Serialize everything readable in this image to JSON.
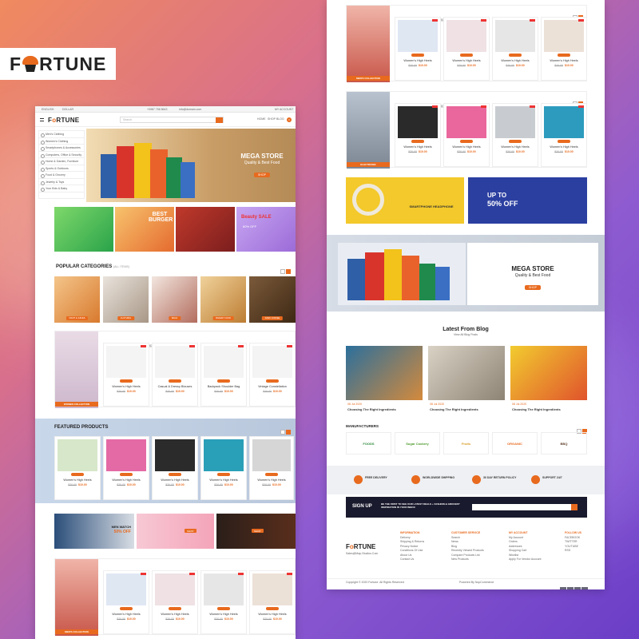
{
  "brand": {
    "name_pre": "F",
    "name_post": "RTUNE",
    "colors": {
      "accent": "#e86a1e",
      "dark": "#1a1a2e"
    }
  },
  "left_page": {
    "topbar": {
      "lang": "ENGLISH",
      "currency": "DOLLAR",
      "phone": "+0987 756 5643",
      "email": "info@domain.com",
      "wishlist": "WL",
      "account": "MY ACCOUNT",
      "cart_count": "0"
    },
    "header": {
      "logo_pre": "F",
      "logo_post": "RTUNE",
      "search_placeholder": "Search",
      "nav": [
        "HOME",
        "SHOP",
        "BLOG",
        "CONTACT US"
      ]
    },
    "sidebar": [
      "Men's Clothing",
      "Women's Clothing",
      "Smartphones & Accessories",
      "Computers, Office & Security",
      "Home & Garden, Furniture",
      "Sports & Outdoors",
      "Food & Grocery",
      "Jewelry & Toys",
      "Your Kids & Baby"
    ],
    "hero": {
      "title": "MEGA STORE",
      "subtitle": "Quality & Best Food",
      "button": "SHOP"
    },
    "promos": [
      {
        "text": ""
      },
      {
        "text": "BEST BURGER"
      },
      {
        "text": ""
      },
      {
        "text": "Beauty SALE",
        "sub": "60% OFF"
      }
    ],
    "popular": {
      "title": "POPULAR CATEGORIES",
      "tag": "(All items)",
      "items": [
        "FRUIT & JUICES",
        "CLOTHING",
        "BAGS",
        "BAKERY FOOD",
        "DARK COFFEE"
      ]
    },
    "products1": {
      "collection": "WOMEN COLLECTION",
      "tabs": [
        "NEW PRODUCT",
        "FEATURED",
        "BESTSELLER",
        "SPECIALS"
      ],
      "items": [
        {
          "name": "Women's High Heels",
          "old": "$20.00",
          "new": "$10.00"
        },
        {
          "name": "Casual & Dressy Blouses",
          "old": "$20.00",
          "new": "$10.00"
        },
        {
          "name": "Backpack Shoulder Bag",
          "old": "$20.00",
          "new": "$10.00"
        },
        {
          "name": "Vintage Constellation",
          "old": "$20.00",
          "new": "$10.00"
        }
      ]
    },
    "featured": {
      "title": "FEATURED PRODUCTS",
      "items": [
        {
          "name": "Women's High Heels",
          "old": "$20.00",
          "new": "$10.00"
        },
        {
          "name": "Women's High Heels",
          "old": "$20.00",
          "new": "$10.00"
        },
        {
          "name": "Women's High Heels",
          "old": "$20.00",
          "new": "$10.00"
        },
        {
          "name": "Women's High Heels",
          "old": "$20.00",
          "new": "$10.00"
        },
        {
          "name": "Women's High Heels",
          "old": "$20.00",
          "new": "$10.00"
        }
      ]
    },
    "banner_row": {
      "watch_title": "MEN WATCH",
      "watch_off": "50% OFF",
      "shop": "SHOP"
    },
    "products2": {
      "collection": "MEN'S COLLECTION",
      "items": [
        {
          "name": "Women's High Heels",
          "old": "$20.00",
          "new": "$10.00"
        },
        {
          "name": "Women's High Heels",
          "old": "$20.00",
          "new": "$10.00"
        },
        {
          "name": "Women's High Heels",
          "old": "$20.00",
          "new": "$10.00"
        },
        {
          "name": "Women's High Heels",
          "old": "$20.00",
          "new": "$10.00"
        }
      ]
    }
  },
  "right_page": {
    "mens": {
      "collection": "MEN'S COLLECTION",
      "items": [
        {
          "name": "Women's High Heels",
          "old": "$20.00",
          "new": "$10.00"
        },
        {
          "name": "Women's High Heels",
          "old": "$20.00",
          "new": "$10.00"
        },
        {
          "name": "Women's High Heels",
          "old": "$20.00",
          "new": "$10.00"
        },
        {
          "name": "Women's High Heels",
          "old": "$20.00",
          "new": "$10.00"
        }
      ]
    },
    "electronic": {
      "collection": "ELECTRONIC",
      "items": [
        {
          "name": "Women's High Heels",
          "old": "$20.00",
          "new": "$10.00"
        },
        {
          "name": "Women's High Heels",
          "old": "$20.00",
          "new": "$10.00"
        },
        {
          "name": "Women's High Heels",
          "old": "$20.00",
          "new": "$10.00"
        },
        {
          "name": "Women's High Heels",
          "old": "$20.00",
          "new": "$10.00"
        }
      ]
    },
    "banners": {
      "headphone": "SMARTPHONE HEADPHONE",
      "upto": "UP TO",
      "off": "50% OFF"
    },
    "mega": {
      "title": "MEGA STORE",
      "subtitle": "Quality & Best Food",
      "button": "SHOP"
    },
    "blog": {
      "title": "Latest From Blog",
      "link": "View All Blog Posts",
      "posts": [
        {
          "date": "08 Jul 2020",
          "title": "Choosing The Right Ingredients"
        },
        {
          "date": "08 Jul 2020",
          "title": "Choosing The Right Ingredients"
        },
        {
          "date": "08 Jul 2020",
          "title": "Choosing The Right Ingredients"
        }
      ]
    },
    "manufacturers": {
      "title": "MANUFACTURERS",
      "brands": [
        "FOODS",
        "Sugar Cookery",
        "Fruits",
        "ORGANIC",
        "BBQ"
      ]
    },
    "services": [
      "FREE DELIVERY",
      "WORLDWIDE SHIPPING",
      "30 DAY RETURN POLICY",
      "SUPPORT 24/7"
    ],
    "signup": {
      "label": "SIGN UP",
      "text": "BE THE FIRST TO SEE OUR LATEST DEALS + FASHION & GROCERY INSPIRATION IN YOUR INBOX"
    },
    "footer": {
      "logo_pre": "F",
      "logo_post": "RTUNE",
      "contact": "Sales@Map-Studios.Com",
      "columns": [
        {
          "title": "INFORMATION",
          "links": [
            "Delivery",
            "Shipping & Returns",
            "Privacy Notice",
            "Conditions Of Use",
            "About Us",
            "Contact Us"
          ]
        },
        {
          "title": "CUSTOMER SERVICE",
          "links": [
            "Search",
            "News",
            "Blog",
            "Recently Viewed Products",
            "Compare Products List",
            "New Products"
          ]
        },
        {
          "title": "MY ACCOUNT",
          "links": [
            "My Account",
            "Orders",
            "Addresses",
            "Shopping Cart",
            "Wishlist",
            "Apply For Vendor Account"
          ]
        },
        {
          "title": "FOLLOW US",
          "links": [
            "FACEBOOK",
            "TWITTER",
            "YOUTUBE",
            "RSS"
          ]
        }
      ],
      "copyright": "Copyright © 2020 Fortune. All Rights Reserved",
      "powered": "Powered By NopCommerce"
    }
  }
}
